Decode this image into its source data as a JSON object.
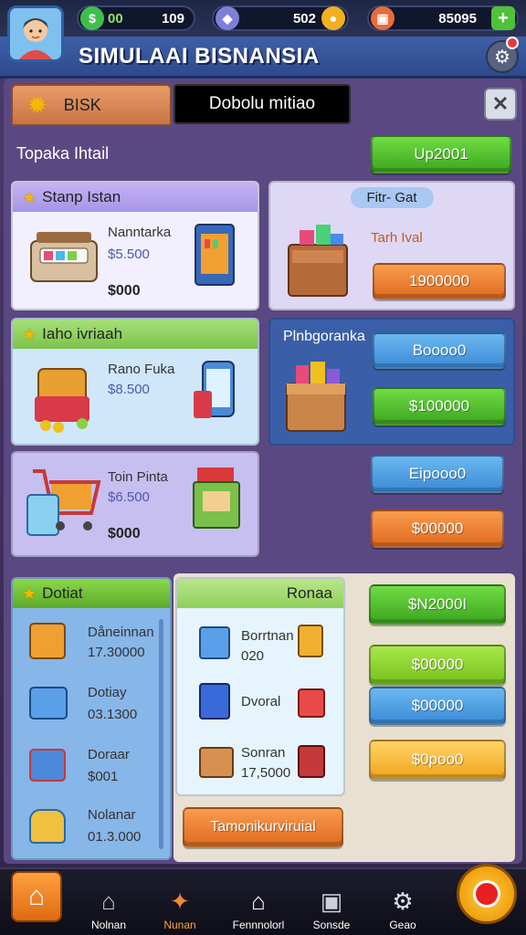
{
  "header": {
    "title": "SIMULAAI BISNANSIA",
    "stats": [
      {
        "icon": "cash-icon",
        "value": "109",
        "color": "#3fbf4a"
      },
      {
        "icon": "gem-icon",
        "value": "502",
        "color": "#7d7fd9"
      },
      {
        "icon": "truck-icon",
        "value": "85095",
        "color": "#e86b3a"
      }
    ],
    "stat_prefix_1": "00",
    "add_label": "+"
  },
  "tabs": {
    "active_label": "BISK",
    "dark_label": "Dobolu mitiao",
    "close_label": "✕"
  },
  "subheader": "Topaka Ihtail",
  "upgrade_button": "Up2001",
  "cards": {
    "card1": {
      "header": "Stanp Istan",
      "name": "Nanntarka",
      "price": "$5.500",
      "value": "$000"
    },
    "card2": {
      "header": "Fitr- Gat",
      "name": "Tarh Ival",
      "button": "1900000"
    },
    "card3": {
      "header": "Iaho ivriaah",
      "name": "Rano Fuka",
      "price": "$8.500"
    },
    "card4": {
      "header": "Plnbgoranka",
      "button1": "Boooo0",
      "button2": "$100000"
    },
    "card5": {
      "name": "Toin Pinta",
      "price": "$6.500",
      "value": "$000"
    },
    "side_buttons": {
      "b1": "Eipooo0",
      "b2": "$00000"
    }
  },
  "bottom_section": {
    "left_header": "Dotiat",
    "left_items": [
      {
        "name": "Dåneinnan",
        "value": "17.30000"
      },
      {
        "name": "Dotiay",
        "value": "03.1300"
      },
      {
        "name": "Doraar",
        "value": "$001"
      },
      {
        "name": "Nolanar",
        "value": "01.3.000"
      }
    ],
    "mid_header": "Ronaa",
    "mid_items": [
      {
        "name": "Borrtnan",
        "value": "020"
      },
      {
        "name": "Dvoral",
        "value": ""
      },
      {
        "name": "Sonran",
        "value": "17,5000"
      }
    ],
    "bottom_button": "Tamonikurviruial",
    "right_buttons": [
      "$N2000I",
      "$00000",
      "$00000",
      "$0poo0"
    ]
  },
  "nav": {
    "items": [
      {
        "label": "Nolnan",
        "icon": "house-icon"
      },
      {
        "label": "Nunan",
        "icon": "market-icon"
      },
      {
        "label": "Fennnolorl",
        "icon": "home-icon"
      },
      {
        "label": "Sonsde",
        "icon": "chat-icon"
      },
      {
        "label": "Geao",
        "icon": "gear-icon"
      }
    ]
  }
}
